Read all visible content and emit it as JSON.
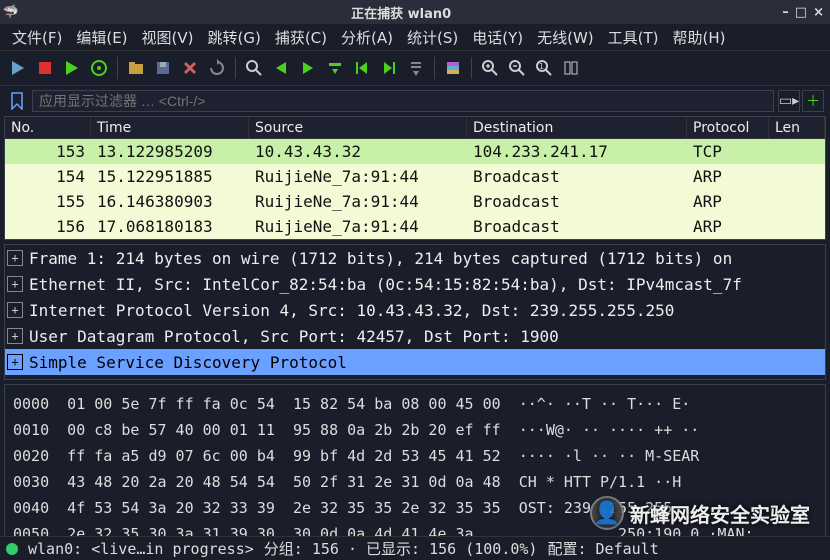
{
  "window": {
    "title": "正在捕获 wlan0"
  },
  "menu": {
    "items": [
      "文件(F)",
      "编辑(E)",
      "视图(V)",
      "跳转(G)",
      "捕获(C)",
      "分析(A)",
      "统计(S)",
      "电话(Y)",
      "无线(W)",
      "工具(T)",
      "帮助(H)"
    ]
  },
  "filter": {
    "placeholder": "应用显示过滤器 … <Ctrl-/>"
  },
  "columns": {
    "no": "No.",
    "time": "Time",
    "source": "Source",
    "destination": "Destination",
    "protocol": "Protocol",
    "length": "Len"
  },
  "packets": [
    {
      "no": "153",
      "time": "13.122985209",
      "src": "10.43.43.32",
      "dst": "104.233.241.17",
      "proto": "TCP",
      "selected": true
    },
    {
      "no": "154",
      "time": "15.122951885",
      "src": "RuijieNe_7a:91:44",
      "dst": "Broadcast",
      "proto": "ARP",
      "selected": false
    },
    {
      "no": "155",
      "time": "16.146380903",
      "src": "RuijieNe_7a:91:44",
      "dst": "Broadcast",
      "proto": "ARP",
      "selected": false
    },
    {
      "no": "156",
      "time": "17.068180183",
      "src": "RuijieNe_7a:91:44",
      "dst": "Broadcast",
      "proto": "ARP",
      "selected": false
    }
  ],
  "details": [
    {
      "label": "Frame 1: 214 bytes on wire (1712 bits), 214 bytes captured (1712 bits) on ",
      "selected": false
    },
    {
      "label": "Ethernet II, Src: IntelCor_82:54:ba (0c:54:15:82:54:ba), Dst: IPv4mcast_7f",
      "selected": false
    },
    {
      "label": "Internet Protocol Version 4, Src: 10.43.43.32, Dst: 239.255.255.250",
      "selected": false
    },
    {
      "label": "User Datagram Protocol, Src Port: 42457, Dst Port: 1900",
      "selected": false
    },
    {
      "label": "Simple Service Discovery Protocol",
      "selected": true
    }
  ],
  "hex": [
    {
      "off": "0000",
      "bytes": "01 00 5e 7f ff fa 0c 54  15 82 54 ba 08 00 45 00",
      "ascii": "  ··^· ··T ·· T··· E·"
    },
    {
      "off": "0010",
      "bytes": "00 c8 be 57 40 00 01 11  95 88 0a 2b 2b 20 ef ff",
      "ascii": "  ···W@· ·· ···· ++ ··"
    },
    {
      "off": "0020",
      "bytes": "ff fa a5 d9 07 6c 00 b4  99 bf 4d 2d 53 45 41 52",
      "ascii": "  ···· ·l ·· ·· M-SEAR"
    },
    {
      "off": "0030",
      "bytes": "43 48 20 2a 20 48 54 54  50 2f 31 2e 31 0d 0a 48",
      "ascii": "  CH * HTT P/1.1 ··H"
    },
    {
      "off": "0040",
      "bytes": "4f 53 54 3a 20 32 33 39  2e 32 35 35 2e 32 35 35",
      "ascii": "  OST: 239 .255.255"
    },
    {
      "off": "0050",
      "bytes": "2e 32 35 30 3a 31 39 30  30 0d 0a 4d 41 4e 3a             ",
      "ascii": "  .250:190 0 ·MAN: "
    }
  ],
  "status": {
    "iface": "wlan0: <live…in progress>",
    "groups": "分组: 156 · 已显示: 156 (100.0%)",
    "config": "配置: Default"
  },
  "watermark": "新蜂网络安全实验室"
}
